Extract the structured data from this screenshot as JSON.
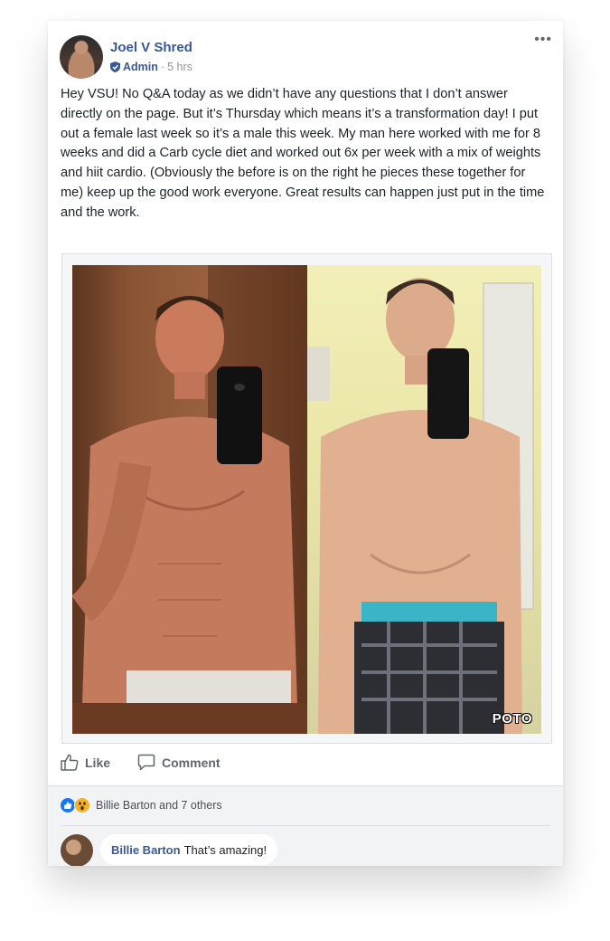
{
  "post": {
    "author": "Joel V Shred",
    "role": "Admin",
    "separator": "·",
    "time": "5 hrs",
    "more_label": "•••",
    "text": "Hey VSU! No Q&A today as we didn’t have any questions that I don’t answer directly on the page. But it’s Thursday which means it’s a transformation day! I put out a female last week so it’s a male this week. My man here worked with me for 8 weeks and did a Carb cycle diet and worked out 6x per week with a mix of weights and hiit cardio. (Obviously the before is on the right he pieces these together for me) keep up the good work everyone. Great results can happen just put in the time and the work.",
    "photo_watermark": "POTO"
  },
  "actions": {
    "like": "Like",
    "comment": "Comment"
  },
  "reactions": {
    "summary": "Billie Barton and 7 others"
  },
  "comment": {
    "author": "Billie Barton",
    "text": "That’s amazing!"
  },
  "colors": {
    "link": "#385898",
    "meta": "#90949c",
    "text": "#1d2129",
    "like_blue": "#1877f2",
    "wow_yellow": "#f7b125"
  }
}
